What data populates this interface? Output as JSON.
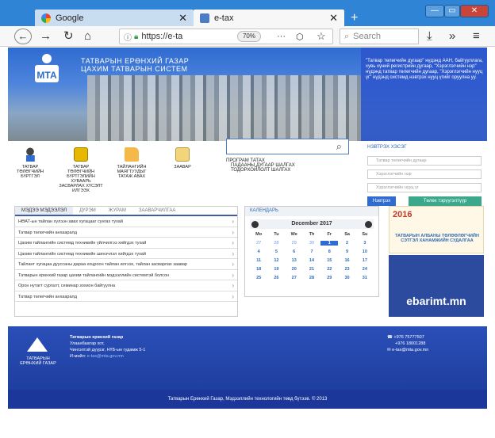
{
  "browser": {
    "tabs": [
      {
        "label": "Google"
      },
      {
        "label": "e-tax"
      }
    ],
    "url": "https://e-ta",
    "zoom": "70%",
    "search_placeholder": "Search"
  },
  "header": {
    "logo_text": "МТА",
    "title_line1": "ТАТВАРЫН ЕРӨНХИЙ ГАЗАР",
    "title_line2": "ЦАХИМ ТАТВАРЫН СИСТЕМ",
    "info": "\"Татвар төлөгчийн дугаар\" нүдэнд ААН, байгууллага, хувь хүний регистрийн дугаар, \"Хэрэглэгчийн нэр\" нүдэнд татвар төлөгчийн дугаар, \"Хэрэглэгчийн нууц үг\" нүдэнд системд нэвтрэх нууц үгийг оруулна уу."
  },
  "icons": [
    {
      "label": "ТАТВАР ТӨЛӨГЧИЙН БҮРТГЭЛ"
    },
    {
      "label": "ТАТВАР ТӨЛӨГЧИЙН БҮРТГЭЛИЙН ХУВААРЬ ЗАСВАРЛАХ ХҮСЭЛТ ИЛГЭЭХ"
    },
    {
      "label": "ТАЙЛАНГИЙН МАЯГТУУДЫГ ТАТАЖ АВАХ"
    },
    {
      "label": "ЗААВАР"
    }
  ],
  "search_links": [
    "ПРОГРАМ ТАТАХ",
    "ПАДААНЫ ДУГААР ШАЛГАХ",
    "ТОДОРХОЙЛОЛТ ШАЛГАХ"
  ],
  "login": {
    "title": "НЭВТРЭХ ХЭСЭГ",
    "fields": [
      "Татвар төлөгчийн дугаар",
      "Хэрэглэгчийн нэр",
      "Хэрэглэгчийн нууц үг"
    ],
    "login_btn": "Нэвтрэх",
    "register_btn": "Төлөх тэрүүгэлтүүр"
  },
  "news": {
    "tabs": [
      "МЭДЭЭ МЭДЭЭЛЭЛ",
      "ДҮРЭМ",
      "ЖУРАМ",
      "ЗААВАРЧИЛГАА"
    ],
    "items": [
      "НӨАТ-ын тайлан хүлээн авах хугацааг сунгах тухай",
      "Татвар төлөгчийн анхааралд",
      "Цахим тайлангийн системд техникийн үйлчилгээ хийгдэх тухай",
      "Цахим тайлангийн системд техникийн шинэчлэл хийгдэх тухай",
      "Тайлант хугацаа дууссаны дараа хоцроон тайлан илгээх, тайлан засварлах заавар",
      "Татварын ерөнхий газар цахим тайлангийн мэдээллийн системтэй болсон",
      "Орон нутагт сургалт, семинар зохион байгуулна",
      "Татвар төлөгчийн анхааралд"
    ]
  },
  "calendar": {
    "title": "КАЛЕНДАРЬ",
    "month": "December 2017",
    "weekdays": [
      "Mo",
      "Tu",
      "We",
      "Th",
      "Fr",
      "Sa",
      "Su"
    ],
    "days": [
      [
        "27",
        "28",
        "29",
        "30",
        "1",
        "2",
        "3"
      ],
      [
        "4",
        "5",
        "6",
        "7",
        "8",
        "9",
        "10"
      ],
      [
        "11",
        "12",
        "13",
        "14",
        "15",
        "16",
        "17"
      ],
      [
        "18",
        "19",
        "20",
        "21",
        "22",
        "23",
        "24"
      ],
      [
        "25",
        "26",
        "27",
        "28",
        "29",
        "30",
        "31"
      ]
    ],
    "selected_day": "1"
  },
  "ads": {
    "ad1_year": "2016",
    "ad1_text": "ТАТВАРЫН АЛБАНЫ ТӨЛӨӨЛӨГЧИЙН СЭТГЭЛ ХАНАМЖИЙН СУДАЛГАА",
    "ad2_text": "ebarimt.mn"
  },
  "footer": {
    "org": "Татварын ерөнхий газар",
    "address1": "Улаанбаатар хот,",
    "address2": "Чингэлтэй дүүрэг, НҮБ-ын гудамж 5-1",
    "email_label": "И-мэйл:",
    "email": "e-tax@mta.gov.mn",
    "phone1": "+976 75777507",
    "phone2": "+976 18001288",
    "contact_email": "e-tax@mta.gov.mn",
    "logo_caption": "ТАТВАРЫН ЕРӨНХИЙ ГАЗАР",
    "copyright": "Татварын Ерөнхий Газар, Мэдээллийн технологийн төвд бүтээв. © 2013"
  },
  "colors": {
    "accent": "#2f6bd1",
    "titlebar": "#2f84d6",
    "green": "#3aa88c"
  }
}
